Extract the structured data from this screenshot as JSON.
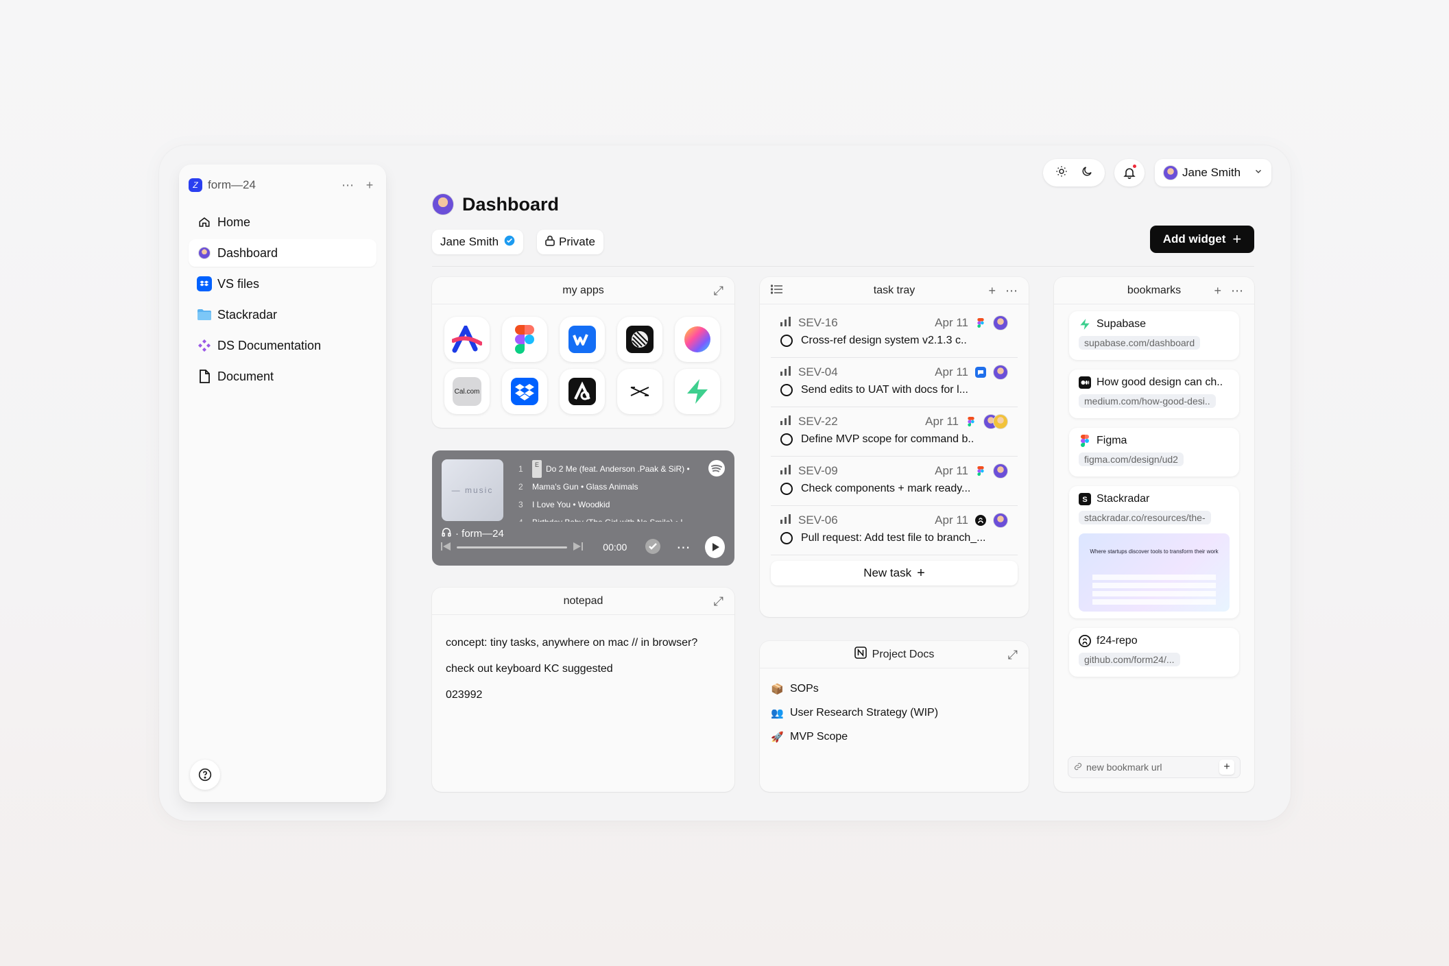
{
  "workspace": {
    "name": "form—24"
  },
  "sidebar": {
    "items": [
      {
        "label": "Home",
        "icon": "home-icon"
      },
      {
        "label": "Dashboard",
        "icon": "avatar"
      },
      {
        "label": "VS files",
        "icon": "dropbox-icon"
      },
      {
        "label": "Stackradar",
        "icon": "folder-icon"
      },
      {
        "label": "DS Documentation",
        "icon": "figma-component-icon"
      },
      {
        "label": "Document",
        "icon": "document-icon"
      }
    ]
  },
  "topbar": {
    "user_name": "Jane Smith"
  },
  "page": {
    "title": "Dashboard",
    "owner_chip": "Jane Smith",
    "visibility_chip": "Private",
    "add_widget_label": "Add widget"
  },
  "widgets": {
    "my_apps": {
      "title": "my apps",
      "apps": [
        "arc-icon",
        "figma-icon",
        "webflow-icon",
        "linear-icon",
        "gradient-app-icon",
        "calcom-icon",
        "dropbox-icon",
        "spline-icon",
        "capcut-icon",
        "supabase-icon"
      ],
      "calcom_label": "Cal.com"
    },
    "music": {
      "album_label": "— music",
      "tracks": [
        {
          "n": "1",
          "explicit": "E",
          "title": "Do 2 Me (feat. Anderson .Paak & SiR) •"
        },
        {
          "n": "2",
          "title": "Mama's Gun • Glass Animals"
        },
        {
          "n": "3",
          "title": "I Love You • Woodkid"
        },
        {
          "n": "4",
          "title": "Birthday Baby (The Girl with No Smile) • I"
        }
      ],
      "source": "· form—24",
      "time": "00:00"
    },
    "notepad": {
      "title": "notepad",
      "lines": [
        "concept: tiny tasks, anywhere on mac // in browser?",
        "check out keyboard KC suggested",
        "023992"
      ]
    },
    "task_tray": {
      "title": "task tray",
      "tasks": [
        {
          "id": "SEV-16",
          "date": "Apr 11",
          "title": "Cross-ref design system v2.1.3 c.."
        },
        {
          "id": "SEV-04",
          "date": "Apr 11",
          "title": "Send edits to UAT with docs for l..."
        },
        {
          "id": "SEV-22",
          "date": "Apr 11",
          "title": "Define MVP scope for command b.."
        },
        {
          "id": "SEV-09",
          "date": "Apr 11",
          "title": "Check components + mark ready..."
        },
        {
          "id": "SEV-06",
          "date": "Apr 11",
          "title": "Pull request: Add test file to branch_..."
        }
      ],
      "new_task_label": "New task"
    },
    "project_docs": {
      "title": "Project Docs",
      "items": [
        {
          "emoji": "📦",
          "label": "SOPs"
        },
        {
          "emoji": "👥",
          "label": "User Research Strategy (WIP)"
        },
        {
          "emoji": "🚀",
          "label": "MVP Scope"
        }
      ]
    },
    "bookmarks": {
      "title": "bookmarks",
      "items": [
        {
          "title": "Supabase",
          "url": "supabase.com/dashboard"
        },
        {
          "title": "How good design can ch..",
          "url": "medium.com/how-good-desi.."
        },
        {
          "title": "Figma",
          "url": "figma.com/design/ud2"
        },
        {
          "title": "Stackradar",
          "url": "stackradar.co/resources/the-"
        },
        {
          "title": "f24-repo",
          "url": "github.com/form24/..."
        }
      ],
      "preview_text": "Where startups discover tools to transform their work",
      "input_placeholder": "new bookmark url"
    }
  },
  "colors": {
    "accent": "#2a3ff0",
    "notification": "#ee2b3a",
    "primary_button": "#0d0d0d"
  }
}
